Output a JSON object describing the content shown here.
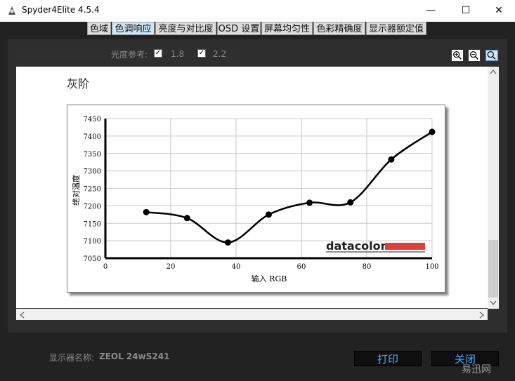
{
  "window": {
    "title": "Spyder4Elite 4.5.4",
    "minimize": "—",
    "maximize": "☐",
    "close": "✕"
  },
  "tabs": [
    {
      "label": "色域"
    },
    {
      "label": "色调响应"
    },
    {
      "label": "亮度与对比度"
    },
    {
      "label": "OSD 设置"
    },
    {
      "label": "屏幕均匀性"
    },
    {
      "label": "色彩精确度"
    },
    {
      "label": "显示器额定值"
    }
  ],
  "toolbar": {
    "label": "光度参考:",
    "opt1": "1.8",
    "opt2": "2.2",
    "opt1_checked": true,
    "opt2_checked": true
  },
  "section_title": "灰阶",
  "chart_data": {
    "type": "line",
    "x": [
      12.5,
      25,
      37.5,
      50,
      62.5,
      75,
      87.5,
      100
    ],
    "values": [
      7182,
      7165,
      7095,
      7175,
      7209,
      7210,
      7333,
      7412
    ],
    "xlabel": "输入 RGB",
    "ylabel": "绝对温度",
    "xlim": [
      0,
      100
    ],
    "ylim": [
      7050,
      7450
    ],
    "xticks": [
      0,
      20,
      40,
      60,
      80,
      100
    ],
    "yticks": [
      7050,
      7100,
      7150,
      7200,
      7250,
      7300,
      7350,
      7400,
      7450
    ],
    "grid": true,
    "line_color": "#000000",
    "logo_text": "datacolor",
    "logo_bar_color": "#e0403a"
  },
  "footer": {
    "monitor_label": "显示器名称:",
    "monitor_name": "ZEOL 24wS241",
    "print_label": "打印",
    "close_label": "关闭",
    "watermark": "易迅网"
  }
}
